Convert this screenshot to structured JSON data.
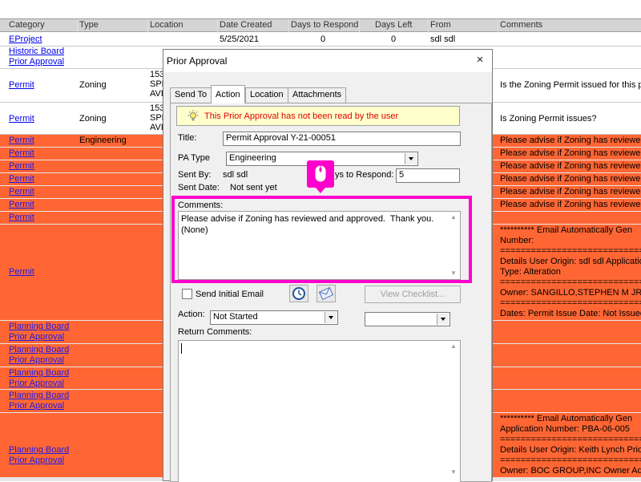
{
  "grid": {
    "headers": [
      "Category",
      "Type",
      "Location",
      "Date Created",
      "Days to Respond",
      "Days Left",
      "From",
      "Comments"
    ],
    "rows": [
      {
        "category": "EProject",
        "category2": "",
        "type": "",
        "location": "",
        "date_created": "5/25/2021",
        "days_to_respond": "0",
        "days_left": "0",
        "from": "sdl sdl",
        "comments": [
          "",
          ""
        ]
      },
      {
        "category": "Historic Board",
        "category2": "Prior Approval",
        "type": "",
        "location": "",
        "date_created": "",
        "days_to_respond": "",
        "days_left": "",
        "from": "",
        "comments": [
          "",
          ""
        ]
      },
      {
        "category": "Permit",
        "category2": "",
        "type": "Zoning",
        "location": "153 SPR AVE",
        "date_created": "",
        "days_to_respond": "",
        "days_left": "",
        "from": "",
        "comments": [
          "Is the Zoning Permit issued for this p",
          ""
        ]
      },
      {
        "category": "Permit",
        "category2": "",
        "type": "Zoning",
        "location": "153 SPR AVE",
        "date_created": "",
        "days_to_respond": "",
        "days_left": "",
        "from": "",
        "comments": [
          "Is Zoning Permit issues?",
          ""
        ]
      },
      {
        "category": "Permit",
        "category2": "",
        "type": "Engineering",
        "location": "",
        "comments": [
          "Please advise if Zoning has reviewed",
          ""
        ]
      },
      {
        "category": "Permit",
        "category2": "",
        "type": "",
        "location": "",
        "comments": [
          "Please advise if Zoning has reviewed",
          ""
        ]
      },
      {
        "category": "Permit",
        "category2": "",
        "type": "",
        "location": "",
        "comments": [
          "Please advise if Zoning has reviewed",
          ""
        ]
      },
      {
        "category": "Permit",
        "category2": "",
        "type": "",
        "location": "",
        "comments": [
          "Please advise if Zoning has reviewed",
          ""
        ]
      },
      {
        "category": "Permit",
        "category2": "",
        "type": "",
        "location": "",
        "comments": [
          "Please advise if Zoning has reviewed",
          ""
        ]
      },
      {
        "category": "Permit",
        "category2": "",
        "type": "",
        "location": "",
        "comments": [
          "Please advise if Zoning has reviewed",
          ""
        ]
      },
      {
        "category": "Permit",
        "category2": "",
        "type": "",
        "location": "",
        "comments": [
          "",
          ""
        ]
      },
      {
        "category": "Permit",
        "category2": "",
        "type": "",
        "location": "",
        "comments": [
          "********** Email Automatically Gen",
          "Number:",
          "================================",
          "Details User Origin: sdl sdl Application",
          "Type: Alteration",
          "================================",
          "Owner: SANGILLO,STEPHEN M JR &",
          "================================",
          "Dates: Permit Issue Date: Not Issued"
        ]
      },
      {
        "category": "Planning Board",
        "category2": "Prior Approval",
        "comments": [
          "",
          ""
        ]
      },
      {
        "category": "Planning Board",
        "category2": "Prior Approval",
        "comments": [
          "",
          ""
        ]
      },
      {
        "category": "Planning Board",
        "category2": "Prior Approval",
        "comments": [
          "",
          ""
        ]
      },
      {
        "category": "Planning Board",
        "category2": "Prior Approval",
        "comments": [
          "",
          ""
        ]
      },
      {
        "category": "Planning Board",
        "category2": "Prior Approval",
        "comments": [
          "********** Email Automatically Gen",
          "Application Number: PBA-06-005",
          "================================",
          "Details User Origin: Keith Lynch Prior",
          "================================",
          "Owner: BOC GROUP,INC Owner Add"
        ]
      }
    ]
  },
  "dialog": {
    "title": "Prior Approval",
    "close_glyph": "×",
    "tabs": [
      "Send To",
      "Action",
      "Location",
      "Attachments"
    ],
    "notice": "This Prior Approval has not been read by the user",
    "title_label": "Title:",
    "title_value": "Permit Approval  Y-21-00051",
    "pa_type_label": "PA Type",
    "pa_type_value": "Engineering",
    "sent_by_label": "Sent By:",
    "sent_by_value": "sdl sdl",
    "days_to_respond_label": "ys to Respond:",
    "days_to_respond_value": "5",
    "sent_date_label": "Sent Date:",
    "sent_date_value": "Not sent yet",
    "comments_label": "Comments:",
    "comments_value": "Please advise if Zoning has reviewed and approved.  Thank you.\n(None)",
    "send_email_label": "Send Initial Email",
    "view_checklist_label": "View Checklist...",
    "action_label": "Action:",
    "action_value": "Not Started",
    "second_select_value": "",
    "return_comments_label": "Return Comments:",
    "return_comments_value": ""
  },
  "colors": {
    "highlight": "#ff00cc",
    "row_orange": "#ff6633",
    "link": "#0000ee",
    "notice_text": "#e00000",
    "notice_bg": "#ffffcc"
  },
  "icons": {
    "notice": "lightbulb-icon",
    "clock": "clock-icon",
    "email": "envelope-icon",
    "mouse": "mouse-icon"
  }
}
